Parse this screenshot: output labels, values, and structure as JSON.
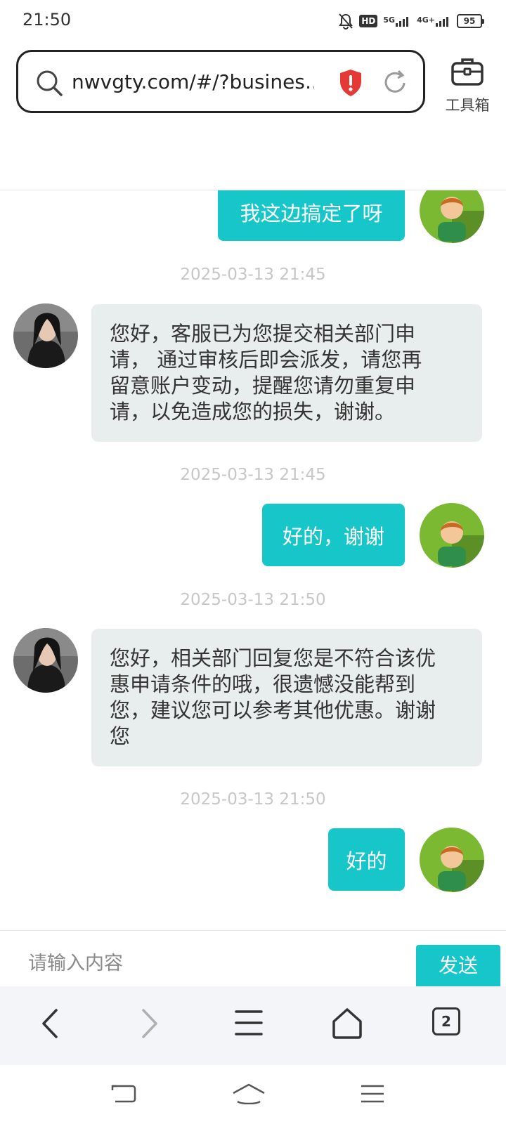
{
  "status_bar": {
    "time": "21:50",
    "network_1": "5G",
    "network_2": "4G+",
    "hd_badge": "HD",
    "battery": "95"
  },
  "browser": {
    "url": "nwvgty.com/#/?busines…",
    "toolbox_label": "工具箱",
    "tabs_count": "2"
  },
  "chat": {
    "messages": [
      {
        "side": "out",
        "text": "我这边搞定了呀"
      },
      {
        "timestamp": "2025-03-13 21:45"
      },
      {
        "side": "in",
        "lines": [
          "您好，客服已为您提交相关部门申",
          "请， 通过审核后即会派发，请您再",
          "留意账户变动，提醒您请勿重复申",
          "请，以免造成您的损失，谢谢。"
        ]
      },
      {
        "timestamp": "2025-03-13 21:45"
      },
      {
        "side": "out",
        "text": "好的，谢谢"
      },
      {
        "timestamp": "2025-03-13 21:50"
      },
      {
        "side": "in",
        "lines": [
          "您好，相关部门回复您是不符合该优",
          "惠申请条件的哦，很遗憾没能帮到",
          "您，建议您可以参考其他优惠。谢谢",
          "您"
        ]
      },
      {
        "timestamp": "2025-03-13 21:50"
      },
      {
        "side": "out",
        "text": "好的"
      }
    ]
  },
  "input": {
    "placeholder": "请输入内容",
    "send_label": "发送"
  },
  "colors": {
    "accent": "#16c6c8",
    "incoming_bubble": "#e8eded",
    "timestamp": "#c7c7c7",
    "shield": "#e53935"
  },
  "icons": {
    "search": "search-icon",
    "shield": "shield-alert-icon",
    "reload": "reload-icon",
    "toolbox": "briefcase-icon",
    "back": "chevron-left-icon",
    "forward": "chevron-right-icon",
    "menu": "menu-icon",
    "home": "home-icon",
    "tabs": "tabs-icon"
  }
}
